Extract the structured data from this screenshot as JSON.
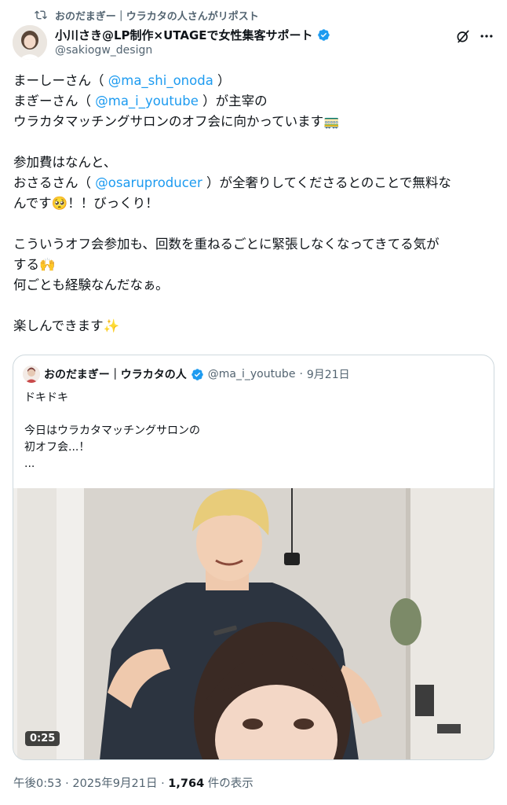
{
  "repost": {
    "text": "おのだまぎー｜ウラカタの人さんがリポスト"
  },
  "author": {
    "name": "小川さき@LP制作×UTAGEで女性集客サポート",
    "handle": "@sakiogw_design"
  },
  "post": {
    "lines": [
      {
        "before": "まーしーさん（ ",
        "mention": "@ma_shi_onoda",
        "after": " ）"
      },
      {
        "before": "まぎーさん（ ",
        "mention": "@ma_i_youtube",
        "after": " ）が主宰の"
      },
      {
        "before": "ウラカタマッチングサロンのオフ会に向かっています🚃",
        "mention": "",
        "after": ""
      },
      {
        "before": "参加費はなんと、",
        "mention": "",
        "after": ""
      },
      {
        "before": "おさるさん（ ",
        "mention": "@osaruproducer",
        "after": " ）が全奢りしてくださるとのことで無料な"
      },
      {
        "before": "んです🥺！！びっくり！",
        "mention": "",
        "after": ""
      },
      {
        "before": "こういうオフ会参加も、回数を重ねるごとに緊張しなくなってきてる気が",
        "mention": "",
        "after": ""
      },
      {
        "before": "する🙌",
        "mention": "",
        "after": ""
      },
      {
        "before": "何ごとも経験なんだなぁ。",
        "mention": "",
        "after": ""
      },
      {
        "before": "楽しんできます✨",
        "mention": "",
        "after": ""
      }
    ]
  },
  "quote": {
    "name": "おのだまぎー｜ウラカタの人",
    "handle": "@ma_i_youtube",
    "separator": "·",
    "date": "9月21日",
    "lines": [
      "ドキドキ",
      "今日はウラカタマッチングサロンの",
      "初オフ会...！",
      "..."
    ],
    "video_duration": "0:25"
  },
  "footer": {
    "time": "午後0:53 · 2025年9月21日 · ",
    "views": "1,764",
    "views_label": " 件の表示"
  },
  "colors": {
    "accent": "#1d9bf0",
    "text": "#0f1419",
    "muted": "#536471",
    "border": "#cfd9de"
  }
}
